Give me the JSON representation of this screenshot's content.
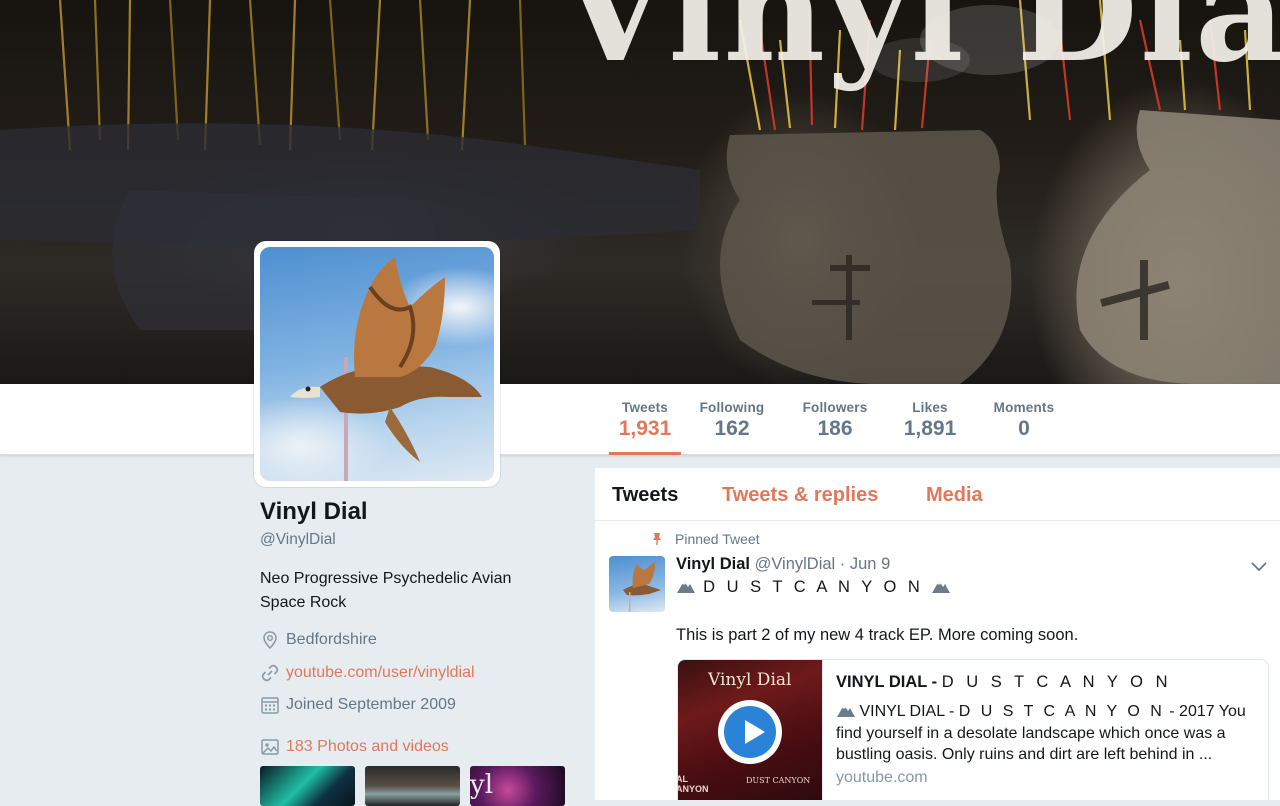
{
  "colors": {
    "accent": "#e0785a",
    "muted": "#657786",
    "text": "#14171a",
    "page_bg": "#e6ecf0"
  },
  "banner": {
    "title_text": "Vinyl Dial"
  },
  "nav": {
    "stats": [
      {
        "label": "Tweets",
        "value": "1,931",
        "active": true
      },
      {
        "label": "Following",
        "value": "162"
      },
      {
        "label": "Followers",
        "value": "186"
      },
      {
        "label": "Likes",
        "value": "1,891"
      },
      {
        "label": "Moments",
        "value": "0"
      }
    ]
  },
  "profile": {
    "name": "Vinyl Dial",
    "handle": "@VinylDial",
    "bio": "Neo Progressive Psychedelic Avian Space Rock",
    "location": "Bedfordshire",
    "location_icon": "map-pin-icon",
    "website": "youtube.com/user/vinyldial",
    "website_icon": "link-icon",
    "joined": "Joined September 2009",
    "joined_icon": "calendar-icon",
    "photos": "183 Photos and videos",
    "photos_icon": "image-icon",
    "thumb3_text": "yl"
  },
  "timeline": {
    "tabs": [
      "Tweets",
      "Tweets & replies",
      "Media"
    ],
    "pinned_label": "Pinned Tweet",
    "tweet": {
      "name": "Vinyl Dial",
      "meta": "@VinylDial · Jun 9",
      "title": "D U S T  C A N Y O N",
      "emoji": "mountain-snow-icon",
      "text": "This is part 2 of my new 4 track EP. More coming soon.",
      "card": {
        "art_title": "Vinyl Dial",
        "art_small": "DUST CANYON",
        "art_left_1": "AL",
        "art_left_2": "ANYON",
        "title_prefix": "VINYL DIAL - ",
        "title_spaced": "D U S T  C A N Y O N",
        "desc_prefix": " VINYL DIAL - ",
        "desc_spaced": "D U S T  C A N Y O N",
        "desc_rest": " - 2017 You find yourself in a desolate landscape which once was a bustling oasis. Only ruins and dirt are left behind in ...",
        "domain": "youtube.com"
      }
    }
  }
}
